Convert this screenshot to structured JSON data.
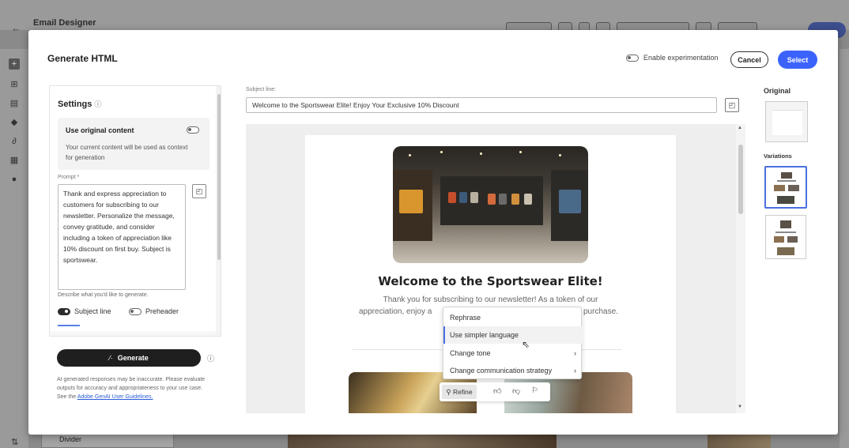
{
  "background": {
    "app_title": "Email Designer",
    "divider_label": "Divider"
  },
  "modal": {
    "title": "Generate HTML",
    "enable_experimentation": "Enable experimentation",
    "cancel_label": "Cancel",
    "select_label": "Select"
  },
  "settings": {
    "title": "Settings",
    "use_original_title": "Use original content",
    "use_original_desc": "Your current content will be used as context for generation",
    "prompt_label": "Prompt *",
    "prompt_text": "Thank and express appreciation to customers for subscribing to our newsletter. Personalize the message, convey gratitude, and consider including a token of appreciation like 10% discount on first buy. Subject is sportswear.",
    "prompt_help": "Describe what you'd like to generate.",
    "subject_line_toggle": "Subject line",
    "preheader_toggle": "Preheader",
    "generate_label": "Generate",
    "disclaimer": "AI generated responses may be inaccurate. Please evaluate outputs for accuracy and appropriateness to your use case. See the",
    "disclaimer_link": "Adobe GenAI User Guidelines."
  },
  "preview": {
    "subject_label": "Subject line:",
    "subject_value": "Welcome to the Sportswear Elite! Enjoy Your Exclusive 10% Discount",
    "heading": "Welcome to the Sportswear Elite!",
    "body_line1": "Thank you for subscribing to our newsletter! As a token of our",
    "body_line2a": "appreciation, enjoy a",
    "body_line2b": "purchase."
  },
  "refine_menu": {
    "items": [
      {
        "label": "Rephrase"
      },
      {
        "label": "Use simpler language"
      },
      {
        "label": "Change tone"
      },
      {
        "label": "Change communication strategy"
      }
    ],
    "highlighted_index": 1,
    "refine_label": "Refine"
  },
  "variations": {
    "original_label": "Original",
    "variations_label": "Variations",
    "selected_index": 0
  },
  "colors": {
    "accent": "#3b63fb",
    "generate_bg": "#1f1f1f",
    "selection_border": "#4a6fe0"
  }
}
